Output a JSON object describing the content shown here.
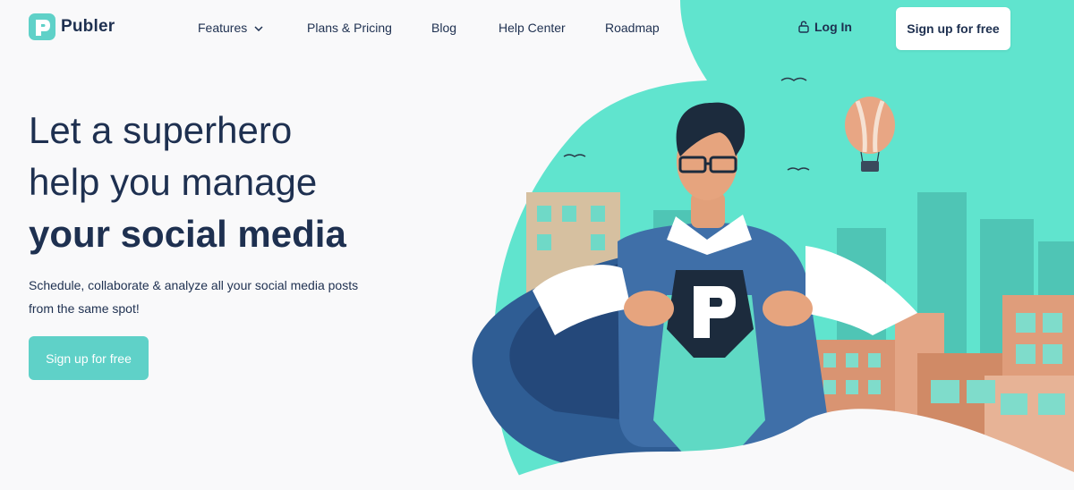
{
  "brand": {
    "name": "Publer",
    "logo_icon": "publer-p-logo-icon",
    "accent_color": "#5fd1c8",
    "text_color": "#1e3050"
  },
  "nav": {
    "items": [
      {
        "label": "Features",
        "has_dropdown": true
      },
      {
        "label": "Plans & Pricing"
      },
      {
        "label": "Blog"
      },
      {
        "label": "Help Center"
      },
      {
        "label": "Roadmap"
      }
    ],
    "login_label": "Log In",
    "login_icon": "lock-icon",
    "signup_label": "Sign up for free"
  },
  "hero": {
    "headline_line1": "Let a superhero",
    "headline_line2": "help you manage",
    "headline_line3": "your social media",
    "subtext": "Schedule, collaborate & analyze all your social media posts from the same spot!",
    "cta_label": "Sign up for free",
    "illustration": "superhero-illustration",
    "illustration_colors": {
      "sky": "#5fe6cf",
      "cape": "#2e5c95",
      "buildings": "#d99472"
    }
  }
}
